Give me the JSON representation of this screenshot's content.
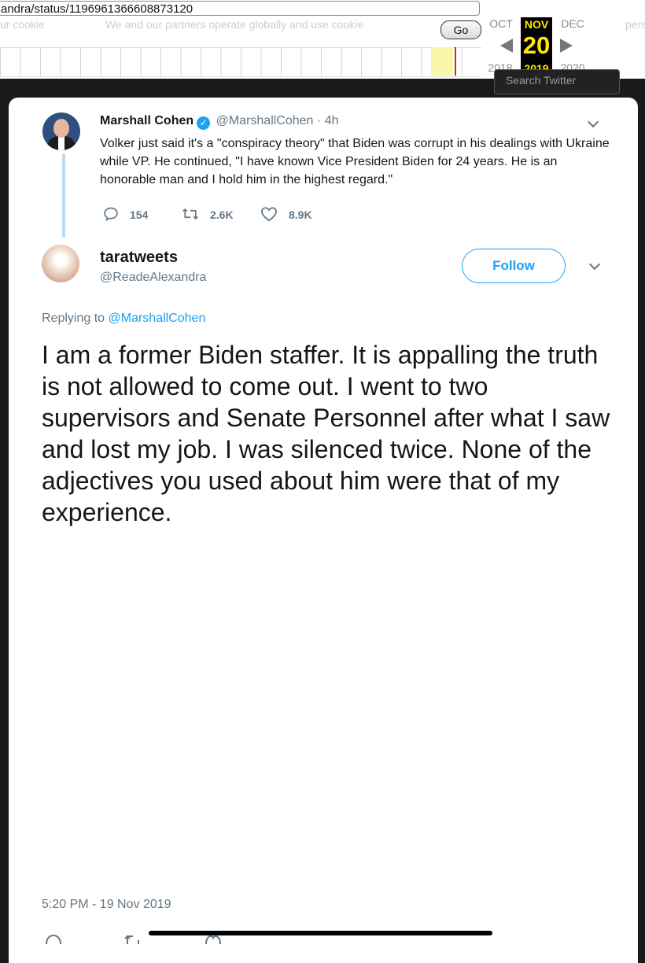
{
  "wayback": {
    "url": "andra/status/1196961366608873120",
    "go_label": "Go",
    "cookie_text_a": "ur cookie",
    "cookie_text_b": "We and our partners operate globally and use cookie",
    "cookie_text_c": "personal",
    "prev_month": "OCT",
    "current_month": "NOV",
    "next_month": "DEC",
    "current_day": "20",
    "prev_year": "2018",
    "current_year": "2019",
    "next_year": "2020",
    "search_ghost": "Search Twitter"
  },
  "tweet1": {
    "name": "Marshall Cohen",
    "handle": "@MarshallCohen",
    "separator": "·",
    "time": "4h",
    "text": "Volker just said it's a \"conspiracy theory\" that Biden was corrupt in his dealings with Ukraine while VP. He continued, \"I have known Vice President Biden for 24 years. He is an honorable man and I hold him in the highest regard.\"",
    "replies": "154",
    "retweets": "2.6K",
    "likes": "8.9K",
    "verified_check": "✓"
  },
  "tweet2": {
    "name": "taratweets",
    "handle": "@ReadeAlexandra",
    "follow_label": "Follow",
    "replying_prefix": "Replying to",
    "replying_handle": "@MarshallCohen",
    "text": "I am a former Biden staffer. It is appalling the truth is not allowed to come out. I went to two supervisors and Senate Personnel after what I saw and lost my job. I was silenced twice. None of the adjectives you used about him were that of my experience.",
    "timestamp": "5:20 PM - 19 Nov 2019"
  },
  "colors": {
    "twitter_blue": "#1da1f2",
    "wayback_yellow": "#ffe600",
    "muted_gray": "#657786"
  }
}
